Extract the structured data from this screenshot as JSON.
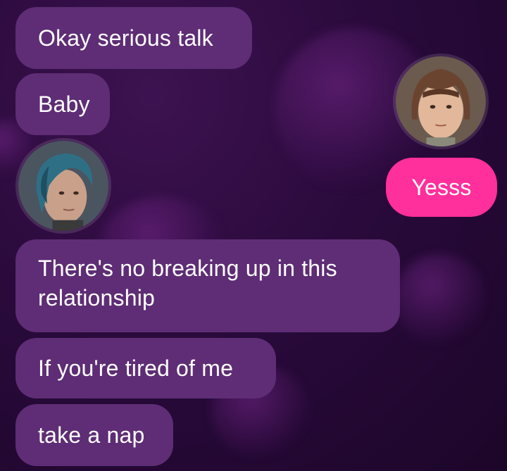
{
  "conversation": {
    "messages": [
      {
        "text": "Okay serious talk",
        "sender": "other"
      },
      {
        "text": "Baby",
        "sender": "other"
      },
      {
        "text": "Yesss",
        "sender": "me"
      },
      {
        "text": "There's no breaking up in this relationship",
        "sender": "other"
      },
      {
        "text": "If you're tired of me",
        "sender": "other"
      },
      {
        "text": "take a nap",
        "sender": "other"
      }
    ]
  },
  "colors": {
    "incoming_bubble": "#5e2d75",
    "outgoing_bubble": "#ff2f9b",
    "background": "#2a0a3c",
    "text": "#ffffff"
  },
  "avatars": {
    "other": "blue-haired-avatar",
    "me": "brown-haired-avatar"
  }
}
